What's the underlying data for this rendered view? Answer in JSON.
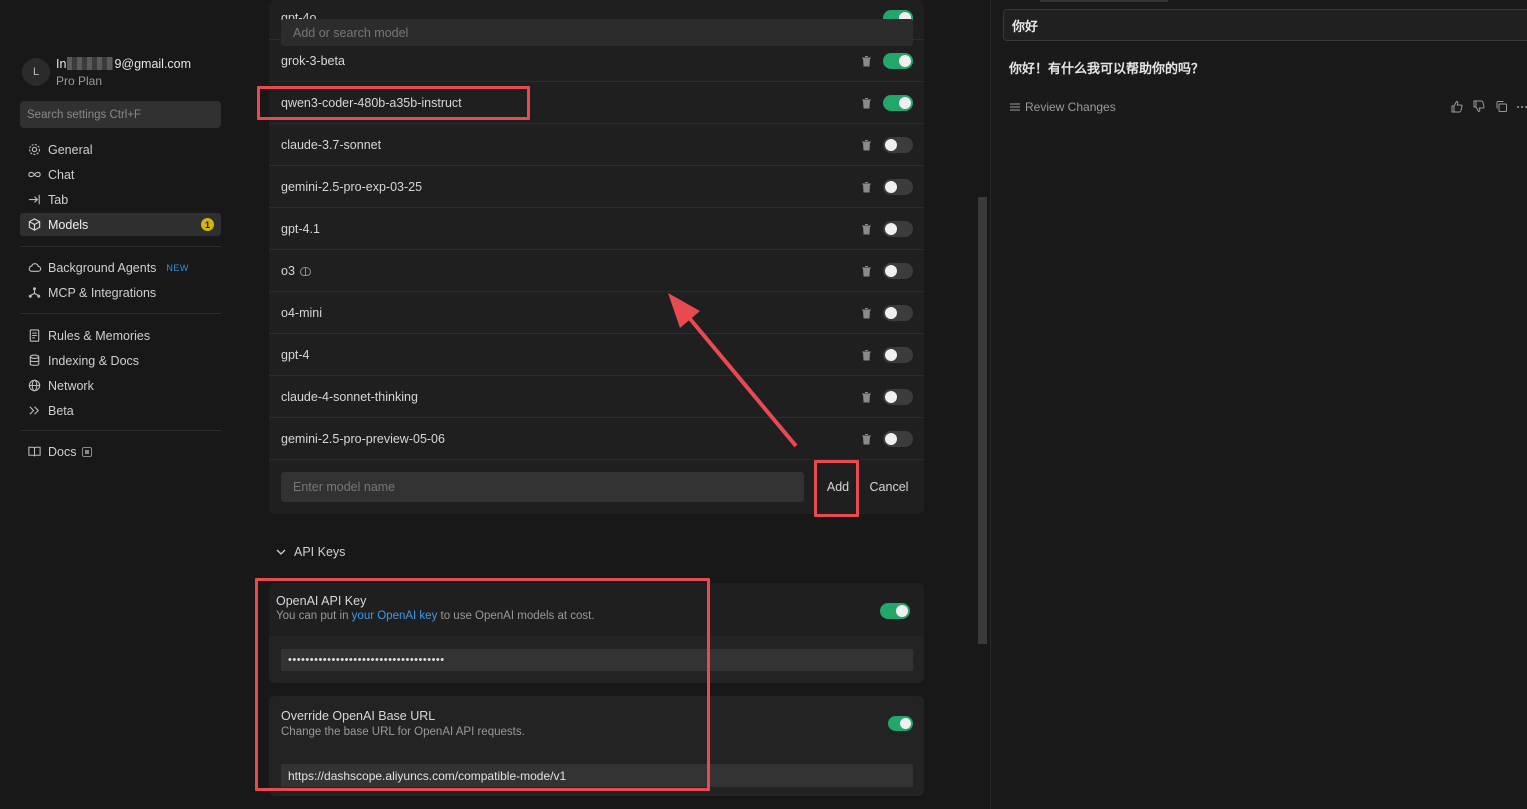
{
  "account": {
    "avatar_letter": "L",
    "email_prefix": "In",
    "email_suffix": "9@gmail.com",
    "plan": "Pro Plan"
  },
  "sidebar": {
    "search_placeholder": "Search settings Ctrl+F",
    "items": [
      {
        "label": "General",
        "icon": "gear-icon"
      },
      {
        "label": "Chat",
        "icon": "infinity-icon"
      },
      {
        "label": "Tab",
        "icon": "tab-arrow-icon"
      },
      {
        "label": "Models",
        "icon": "cube-icon",
        "active": true,
        "badge": "1"
      },
      {
        "label": "Background Agents",
        "icon": "cloud-icon",
        "tag": "NEW"
      },
      {
        "label": "MCP & Integrations",
        "icon": "nodes-icon"
      },
      {
        "label": "Rules & Memories",
        "icon": "document-icon"
      },
      {
        "label": "Indexing & Docs",
        "icon": "database-icon"
      },
      {
        "label": "Network",
        "icon": "globe-icon"
      },
      {
        "label": "Beta",
        "icon": "double-chevron-icon"
      },
      {
        "label": "Docs",
        "icon": "book-icon"
      }
    ]
  },
  "models": {
    "search_placeholder": "Add or search model",
    "partial_top_label": "gpt-4o",
    "list": [
      {
        "name": "grok-3-beta",
        "enabled": true
      },
      {
        "name": "qwen3-coder-480b-a35b-instruct",
        "enabled": true
      },
      {
        "name": "claude-3.7-sonnet",
        "enabled": false
      },
      {
        "name": "gemini-2.5-pro-exp-03-25",
        "enabled": false
      },
      {
        "name": "gpt-4.1",
        "enabled": false
      },
      {
        "name": "o3",
        "enabled": false,
        "thinking": true
      },
      {
        "name": "o4-mini",
        "enabled": false
      },
      {
        "name": "gpt-4",
        "enabled": false
      },
      {
        "name": "claude-4-sonnet-thinking",
        "enabled": false
      },
      {
        "name": "gemini-2.5-pro-preview-05-06",
        "enabled": false
      }
    ],
    "new_model_placeholder": "Enter model name",
    "add_label": "Add",
    "cancel_label": "Cancel"
  },
  "api_keys": {
    "section_label": "API Keys",
    "openai": {
      "title": "OpenAI API Key",
      "desc_prefix": "You can put in ",
      "desc_link": "your OpenAI key",
      "desc_suffix": " to use OpenAI models at cost.",
      "enabled": true,
      "value": "••••••••••••••••••••••••••••••••••••"
    },
    "base_url": {
      "title": "Override OpenAI Base URL",
      "desc": "Change the base URL for OpenAI API requests.",
      "enabled": true,
      "value": "https://dashscope.aliyuncs.com/compatible-mode/v1"
    }
  },
  "chat": {
    "user_message": "你好",
    "assistant_message": "你好！有什么我可以帮助你的吗？",
    "review_changes": "Review Changes"
  },
  "colors": {
    "toggle_on": "#23a66a",
    "annotation": "#e84a50",
    "link": "#3c9ae8",
    "badge": "#d6b40d"
  }
}
